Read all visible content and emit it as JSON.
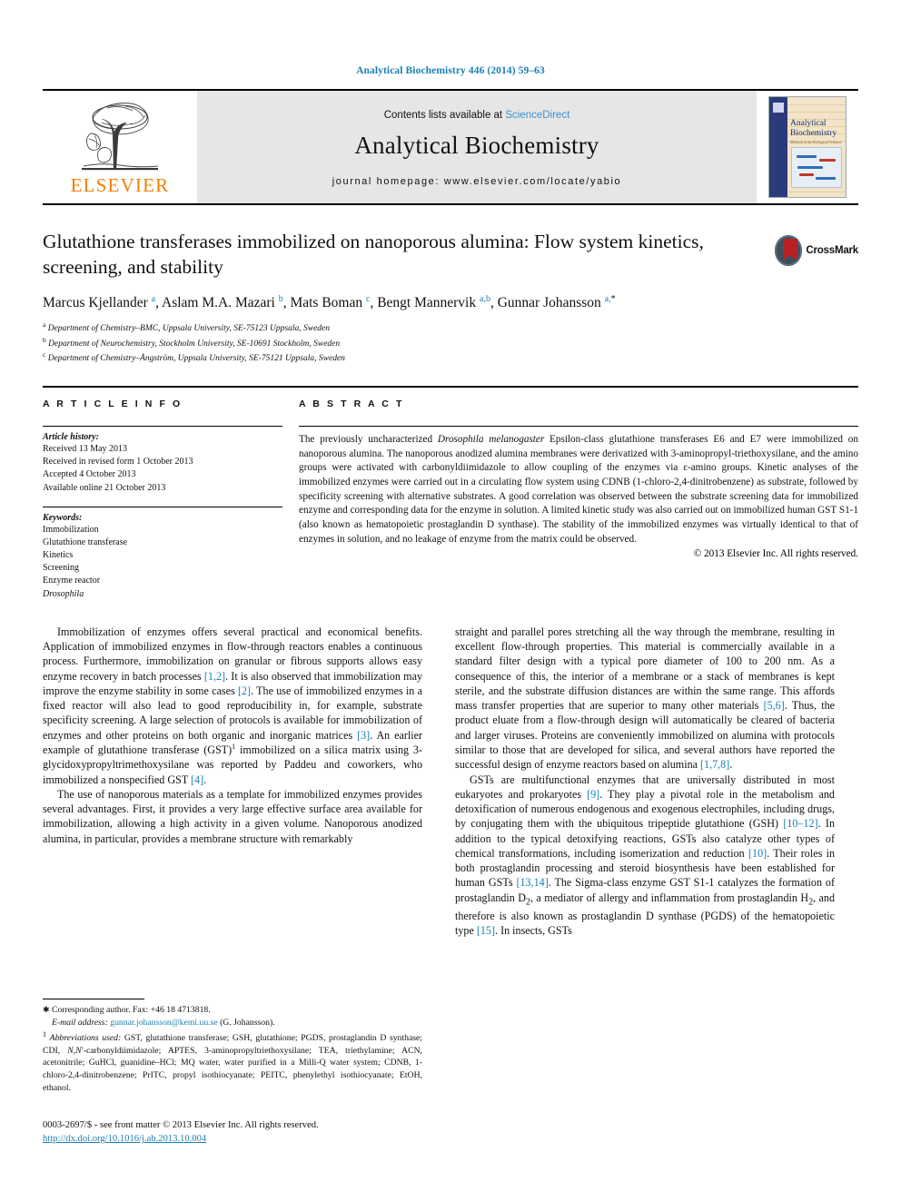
{
  "running_head": "Analytical Biochemistry 446 (2014) 59–63",
  "masthead": {
    "publisher": "ELSEVIER",
    "contents_prefix": "Contents lists available at ",
    "contents_link": "ScienceDirect",
    "journal_title": "Analytical Biochemistry",
    "homepage": "journal homepage: www.elsevier.com/locate/yabio",
    "cover": {
      "line1": "Analytical",
      "line2": "Biochemistry",
      "line3": "Methods in the Biological Sciences"
    }
  },
  "article": {
    "title": "Glutathione transferases immobilized on nanoporous alumina: Flow system kinetics, screening, and stability",
    "crossmark_label": "CrossMark",
    "authors_html": "Marcus Kjellander <sup>a</sup>, Aslam M.A. Mazari <sup>b</sup>, Mats Boman <sup>c</sup>, Bengt Mannervik <sup>a,b</sup>, Gunnar Johansson <sup>a,</sup><sup class=\"ast\">*</sup>",
    "affiliations": [
      {
        "mark": "a",
        "text": "Department of Chemistry–BMC, Uppsala University, SE-75123 Uppsala, Sweden"
      },
      {
        "mark": "b",
        "text": "Department of Neurochemistry, Stockholm University, SE-10691 Stockholm, Sweden"
      },
      {
        "mark": "c",
        "text": "Department of Chemistry–Ångström, Uppsala University, SE-75121 Uppsala, Sweden"
      }
    ]
  },
  "info": {
    "heading": "A R T I C L E    I N F O",
    "history_label": "Article history:",
    "history": [
      "Received 13 May 2013",
      "Received in revised form 1 October 2013",
      "Accepted 4 October 2013",
      "Available online 21 October 2013"
    ],
    "keywords_label": "Keywords:",
    "keywords": [
      "Immobilization",
      "Glutathione transferase",
      "Kinetics",
      "Screening",
      "Enzyme reactor",
      "Drosophila"
    ]
  },
  "abstract": {
    "heading": "A B S T R A C T",
    "text_html": "The previously uncharacterized <i>Drosophila melanogaster</i> Epsilon-class glutathione transferases E6 and E7 were immobilized on nanoporous alumina. The nanoporous anodized alumina membranes were derivatized with 3-aminopropyl-triethoxysilane, and the amino groups were activated with carbonyldiimidazole to allow coupling of the enzymes via &#949;-amino groups. Kinetic analyses of the immobilized enzymes were carried out in a circulating flow system using CDNB (1-chloro-2,4-dinitrobenzene) as substrate, followed by specificity screening with alternative substrates. A good correlation was observed between the substrate screening data for immobilized enzyme and corresponding data for the enzyme in solution. A limited kinetic study was also carried out on immobilized human GST S1-1 (also known as hematopoietic prostaglandin D synthase). The stability of the immobilized enzymes was virtually identical to that of enzymes in solution, and no leakage of enzyme from the matrix could be observed.",
    "copyright": "© 2013 Elsevier Inc. All rights reserved."
  },
  "body": {
    "left": [
      "Immobilization of enzymes offers several practical and economical benefits. Application of immobilized enzymes in flow-through reactors enables a continuous process. Furthermore, immobilization on granular or fibrous supports allows easy enzyme recovery in batch processes <span class=\"ref\">[1,2]</span>. It is also observed that immobilization may improve the enzyme stability in some cases <span class=\"ref\">[2]</span>. The use of immobilized enzymes in a fixed reactor will also lead to good reproducibility in, for example, substrate specificity screening. A large selection of protocols is available for immobilization of enzymes and other proteins on both organic and inorganic matrices <span class=\"ref\">[3]</span>. An earlier example of glutathione transferase (GST)<span class=\"sup\">1</span> immobilized on a silica matrix using 3-glycidoxypropyltrimethoxysilane was reported by Paddeu and coworkers, who immobilized a nonspecified GST <span class=\"ref\">[4]</span>.",
      "The use of nanoporous materials as a template for immobilized enzymes provides several advantages. First, it provides a very large effective surface area available for immobilization, allowing a high activity in a given volume. Nanoporous anodized alumina, in particular, provides a membrane structure with remarkably"
    ],
    "right": [
      "straight and parallel pores stretching all the way through the membrane, resulting in excellent flow-through properties. This material is commercially available in a standard filter design with a typical pore diameter of 100 to 200 nm. As a consequence of this, the interior of a membrane or a stack of membranes is kept sterile, and the substrate diffusion distances are within the same range. This affords mass transfer properties that are superior to many other materials <span class=\"ref\">[5,6]</span>. Thus, the product eluate from a flow-through design will automatically be cleared of bacteria and larger viruses. Proteins are conveniently immobilized on alumina with protocols similar to those that are developed for silica, and several authors have reported the successful design of enzyme reactors based on alumina <span class=\"ref\">[1,7,8]</span>.",
      "GSTs are multifunctional enzymes that are universally distributed in most eukaryotes and prokaryotes <span class=\"ref\">[9]</span>. They play a pivotal role in the metabolism and detoxification of numerous endogenous and exogenous electrophiles, including drugs, by conjugating them with the ubiquitous tripeptide glutathione (GSH) <span class=\"ref\">[10–12]</span>. In addition to the typical detoxifying reactions, GSTs also catalyze other types of chemical transformations, including isomerization and reduction <span class=\"ref\">[10]</span>. Their roles in both prostaglandin processing and steroid biosynthesis have been established for human GSTs <span class=\"ref\">[13,14]</span>. The Sigma-class enzyme GST S1-1 catalyzes the formation of prostaglandin D<sub>2</sub>, a mediator of allergy and inflammation from prostaglandin H<sub>2</sub>, and therefore is also known as prostaglandin D synthase (PGDS) of the hematopoietic type <span class=\"ref\">[15]</span>. In insects, GSTs"
    ]
  },
  "footnotes": {
    "corresponding_html": "<span class=\"fn-mark\">&#10033;</span> Corresponding author. Fax: +46 18 4713818.",
    "email_html": "<i>E-mail address:</i> <span class=\"mail\">gunnar.johansson@kemi.uu.se</span> (G. Johansson).",
    "abbrev_html": "<sup>1</sup> <i>Abbreviations used:</i> GST, glutathione transferase; GSH, glutathione; PGDS, prostaglandin D synthase; CDI, <i>N</i>,<i>N</i>&#8242;-carbonyldiimidazole; APTES, 3-aminopropyltriethoxysilane; TEA, triethylamine; ACN, acetonitrile; GuHCl, guanidine–HCl; MQ water, water purified in a Milli-Q water system; CDNB, 1-chloro-2,4-dinitrobenzene; PrITC, propyl isothiocyanate; PEITC, phenylethyl isothiocyanate; EtOH, ethanol."
  },
  "footer": {
    "issn_line": "0003-2697/$ - see front matter © 2013 Elsevier Inc. All rights reserved.",
    "doi_line": "http://dx.doi.org/10.1016/j.ab.2013.10.004"
  },
  "colors": {
    "link_blue": "#1a7fb5",
    "sciencedirect_blue": "#3b92d0",
    "elsevier_orange": "#F08000",
    "band_gray": "#e6e6e6"
  }
}
